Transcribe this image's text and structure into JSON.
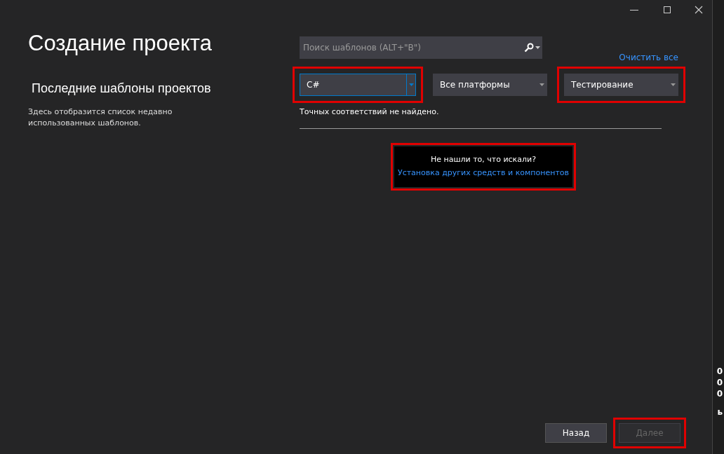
{
  "title": "Создание проекта",
  "recent": {
    "heading": "Последние шаблоны проектов",
    "description": "Здесь отобразится список недавно использованных шаблонов."
  },
  "search": {
    "placeholder": "Поиск шаблонов (ALT+\"B\")"
  },
  "clear_link": "Очистить все",
  "filters": [
    {
      "value": "C#",
      "focused": true,
      "highlighted": true
    },
    {
      "value": "Все платформы",
      "focused": false,
      "highlighted": false
    },
    {
      "value": "Тестирование",
      "focused": false,
      "highlighted": true
    }
  ],
  "no_results": "Точных соответствий не найдено.",
  "promo": {
    "question": "Не нашли то, что искали?",
    "link": "Установка других средств и компонентов",
    "highlighted": true
  },
  "buttons": [
    {
      "label": "Назад",
      "disabled": false,
      "highlighted": false
    },
    {
      "label": "Далее",
      "disabled": true,
      "highlighted": true
    }
  ],
  "background_window": [
    "0",
    "0",
    "0",
    "ь"
  ]
}
